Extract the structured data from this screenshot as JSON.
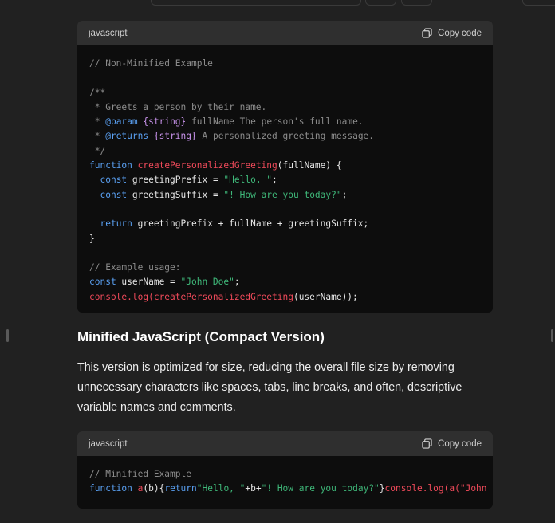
{
  "code_block_1": {
    "language": "javascript",
    "copy_label": "Copy code",
    "comment_header": "// Non-Minified Example",
    "jsdoc_open": "/**",
    "jsdoc_desc": " * Greets a person by their name.",
    "jsdoc_param_tag": "@param",
    "jsdoc_param_type": "{string}",
    "jsdoc_param_text": " fullName The person's full name.",
    "jsdoc_returns_tag": "@returns",
    "jsdoc_returns_type": "{string}",
    "jsdoc_returns_text": " A personalized greeting message.",
    "jsdoc_close": " */",
    "kw_function": "function",
    "fn_name": "createPersonalizedGreeting",
    "fn_params": "(fullName) {",
    "kw_const": "const",
    "prefix_decl": " greetingPrefix = ",
    "prefix_value": "\"Hello, \"",
    "suffix_decl": " greetingSuffix = ",
    "suffix_value": "\"! How are you today?\"",
    "kw_return": "return",
    "return_expr": " greetingPrefix + fullName + greetingSuffix;",
    "close_brace": "}",
    "usage_comment": "// Example usage:",
    "username_decl": " userName = ",
    "username_value": "\"John Doe\"",
    "console_log": "console.log(",
    "call_args": "(userName));"
  },
  "section_title": "Minified JavaScript (Compact Version)",
  "paragraph": "This version is optimized for size, reducing the overall file size by removing unnecessary characters like spaces, tabs, line breaks, and often, descriptive variable names and comments.",
  "code_block_2": {
    "language": "javascript",
    "copy_label": "Copy code",
    "comment": "// Minified Example",
    "kw_function": "function",
    "fn_name": "a",
    "params": "(b){",
    "kw_return": "return",
    "str_hello": "\"Hello, \"",
    "plus_b_plus": "+b+",
    "str_how": "\"! How are you today?\"",
    "close": "}",
    "console_log": "console.log(",
    "call": "a(\"John D"
  },
  "icons": {
    "copy": "copy-icon"
  }
}
